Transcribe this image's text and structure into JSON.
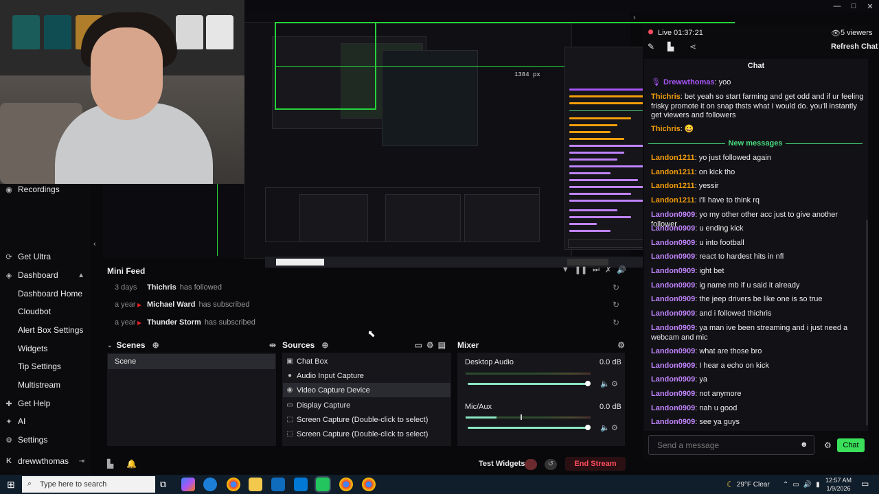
{
  "window": {
    "min": "—",
    "max": "□",
    "close": "✕"
  },
  "preview": {
    "px_readout": "1384 px"
  },
  "sidebar": {
    "items": [
      {
        "icon": "record-icon",
        "glyph": "◉",
        "label": "Recordings"
      },
      {
        "icon": "ultra-icon",
        "glyph": "⟳",
        "label": "Get Ultra"
      },
      {
        "icon": "dashboard-icon",
        "glyph": "◈",
        "label": "Dashboard"
      },
      {
        "label": "Dashboard Home"
      },
      {
        "label": "Cloudbot"
      },
      {
        "label": "Alert Box Settings"
      },
      {
        "label": "Widgets"
      },
      {
        "label": "Tip Settings"
      },
      {
        "label": "Multistream"
      },
      {
        "icon": "help-icon",
        "glyph": "✚",
        "label": "Get Help"
      },
      {
        "icon": "ai-icon",
        "glyph": "✦",
        "label": "AI"
      },
      {
        "icon": "settings-icon",
        "glyph": "⚙",
        "label": "Settings"
      }
    ],
    "account": "drewwthomas"
  },
  "minifeed": {
    "title": "Mini Feed",
    "rows": [
      {
        "time": "3 days",
        "name": "Thichris",
        "action": "has followed"
      },
      {
        "time": "a year",
        "name": "Michael Ward",
        "action": "has subscribed"
      },
      {
        "time": "a year",
        "name": "Thunder Storm",
        "action": "has subscribed"
      }
    ]
  },
  "scenes": {
    "title": "Scenes",
    "items": [
      "Scene"
    ]
  },
  "sources": {
    "title": "Sources",
    "items": [
      {
        "label": "Chat Box",
        "icon": "chat-icon",
        "glyph": "💬"
      },
      {
        "label": "Audio Input Capture",
        "icon": "mic-icon",
        "glyph": "🎙"
      },
      {
        "label": "Video Capture Device",
        "icon": "camera-icon",
        "glyph": "📷"
      },
      {
        "label": "Display Capture",
        "icon": "monitor-icon",
        "glyph": "🖵"
      },
      {
        "label": "Screen Capture (Double-click to select)",
        "icon": "screen-capture-icon",
        "glyph": "⬚"
      },
      {
        "label": "Screen Capture (Double-click to select)",
        "icon": "screen-capture-icon",
        "glyph": "⬚"
      }
    ]
  },
  "mixer": {
    "title": "Mixer",
    "channels": [
      {
        "name": "Desktop Audio",
        "db": "0.0 dB",
        "volume": 1.0,
        "level": 0
      },
      {
        "name": "Mic/Aux",
        "db": "0.0 dB",
        "volume": 1.0,
        "level": 0.25
      }
    ]
  },
  "bottom": {
    "test_widgets": "Test Widgets",
    "end_stream": "End Stream"
  },
  "chat": {
    "live": "Live",
    "time": "01:37:21",
    "viewers": "5 viewers",
    "refresh": "Refresh Chat",
    "title": "Chat",
    "new_messages": "New messages",
    "messages": [
      {
        "user": "Drewwthomas",
        "text": "yoo",
        "color": "ua"
      },
      {
        "user": "Thichris",
        "text": "bet yeah so start farming and get odd and if ur feeling frisky promote it on snap thsts what I would do. you'll instantly get viewers and followers",
        "color": "ub"
      },
      {
        "user": "Thichris",
        "text": "😀",
        "color": "ub"
      },
      {
        "user": "Landon1211",
        "text": "yo just followed again",
        "color": "ub"
      },
      {
        "user": "Landon1211",
        "text": "on kick tho",
        "color": "ub"
      },
      {
        "user": "Landon1211",
        "text": "yessir",
        "color": "ub"
      },
      {
        "user": "Landon1211",
        "text": "I'll have to think rq",
        "color": "ub"
      },
      {
        "user": "Landon0909",
        "text": "yo my other other acc just to give another follower",
        "color": "uc"
      },
      {
        "user": "Landon0909",
        "text": "u ending kick",
        "color": "uc"
      },
      {
        "user": "Landon0909",
        "text": "u into football",
        "color": "uc"
      },
      {
        "user": "Landon0909",
        "text": "react to hardest hits in nfl",
        "color": "uc"
      },
      {
        "user": "Landon0909",
        "text": "ight bet",
        "color": "uc"
      },
      {
        "user": "Landon0909",
        "text": "ig name mb if u said it already",
        "color": "uc"
      },
      {
        "user": "Landon0909",
        "text": "the jeep drivers be like one is so true",
        "color": "uc"
      },
      {
        "user": "Landon0909",
        "text": "and i followed thichris",
        "color": "uc"
      },
      {
        "user": "Landon0909",
        "text": "ya man ive been streaming and i just need a webcam and mic",
        "color": "uc"
      },
      {
        "user": "Landon0909",
        "text": "what are those bro",
        "color": "uc"
      },
      {
        "user": "Landon0909",
        "text": "I hear a echo on kick",
        "color": "uc"
      },
      {
        "user": "Landon0909",
        "text": "ya",
        "color": "uc"
      },
      {
        "user": "Landon0909",
        "text": "not anymore",
        "color": "uc"
      },
      {
        "user": "Landon0909",
        "text": "nah u good",
        "color": "uc"
      },
      {
        "user": "Landon0909",
        "text": "see ya guys",
        "color": "uc"
      }
    ],
    "input_placeholder": "Send a message",
    "send": "Chat"
  },
  "taskbar": {
    "search_placeholder": "Type here to search",
    "weather": "29°F  Clear",
    "time": "12:57 AM",
    "date": "1/9/2026"
  },
  "colors": {
    "accent": "#4ade80",
    "end_stream": "#ff4d5e",
    "chat_user_purple": "#a855f7",
    "chat_user_orange": "#f59e0b"
  }
}
